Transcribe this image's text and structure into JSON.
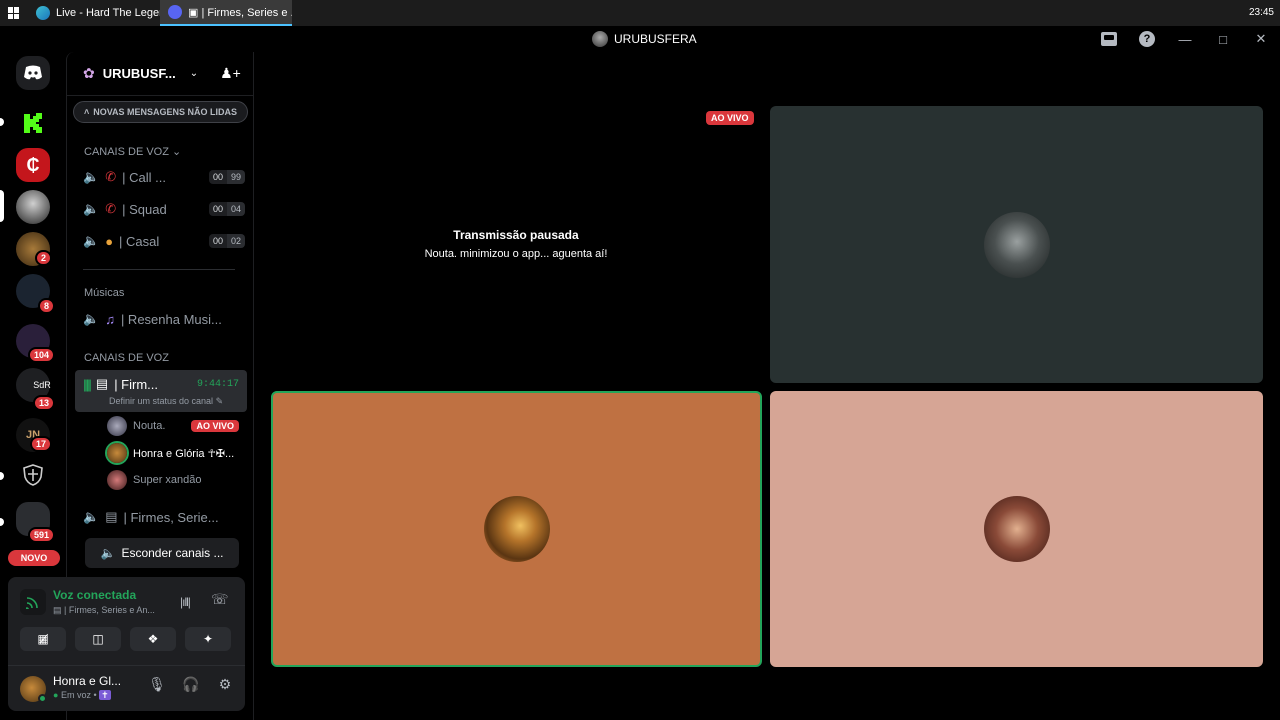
{
  "taskbar": {
    "tabs": [
      {
        "label": "Live - Hard The Legen..."
      },
      {
        "label": "▣ | Firmes, Series e ..."
      }
    ],
    "clock": "23:45"
  },
  "titlebar": {
    "title": "URUBUSFERA"
  },
  "servers": {
    "badges": [
      "2",
      "8",
      "104",
      "13",
      "17",
      "591"
    ],
    "novo": "NOVO",
    "sdr_label": "SdR"
  },
  "sidebar": {
    "server_name": "URUBUSF...",
    "unread": "NOVAS MENSAGENS NÃO LIDAS",
    "cat1": "CANAIS DE VOZ",
    "channels1": [
      {
        "name": "| Call ...",
        "c1": "00",
        "c2": "99"
      },
      {
        "name": "| Squad",
        "c1": "00",
        "c2": "04"
      },
      {
        "name": "| Casal",
        "c1": "00",
        "c2": "02"
      }
    ],
    "cat2": "Músicas",
    "music_channel": "| Resenha Musi...",
    "cat3": "CANAIS DE VOZ",
    "active_channel": {
      "name": "| Firm...",
      "timer": "9:44:17",
      "status": "Definir um status do canal"
    },
    "members": [
      {
        "name": "Nouta.",
        "tag": "AO VIVO"
      },
      {
        "name": "Honra e Glória ☥✠..."
      },
      {
        "name": "Super xandão"
      }
    ],
    "other_channel": "| Firmes, Serie...",
    "hide_btn": "Esconder canais ..."
  },
  "voice": {
    "connected": "Voz conectada",
    "channel": "| Firmes, Series e An..."
  },
  "user": {
    "name": "Honra e Gl...",
    "status": "Em voz •"
  },
  "stage": {
    "live_badge": "AO VIVO",
    "paused_title": "Transmissão pausada",
    "paused_sub": "Nouta. minimizou o app... aguenta aí!"
  },
  "colors": {
    "tile_dark": "#283131",
    "tile_orange": "#bf7142",
    "tile_pink": "#d6a595",
    "speaking": "#23a55a",
    "danger": "#da373c"
  }
}
